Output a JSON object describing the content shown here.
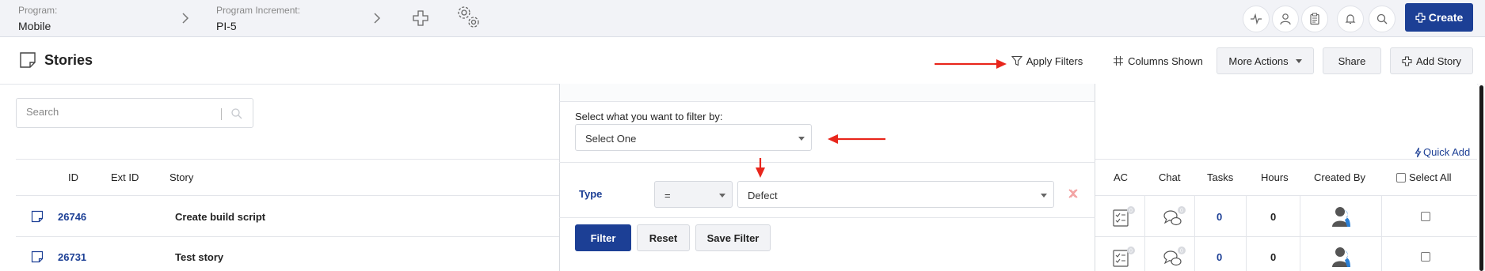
{
  "topbar": {
    "program_label": "Program:",
    "program_value": "Mobile",
    "pi_label": "Program Increment:",
    "pi_value": "PI-5",
    "create_label": "Create",
    "icons": [
      "plus-icon",
      "gears-icon",
      "activity-icon",
      "user-icon",
      "clipboard-icon",
      "bell-icon",
      "search-icon"
    ]
  },
  "page": {
    "title": "Stories",
    "apply_filters": "Apply Filters",
    "columns_shown": "Columns Shown",
    "more_actions": "More Actions",
    "share": "Share",
    "add_story": "Add Story"
  },
  "left_table": {
    "search_placeholder": "Search",
    "headers": [
      "ID",
      "Ext ID",
      "Story"
    ],
    "rows": [
      {
        "id": "26746",
        "ext_id": "",
        "story": "Create build script"
      },
      {
        "id": "26731",
        "ext_id": "",
        "story": "Test story"
      }
    ]
  },
  "filter": {
    "prompt": "Select what you want to filter by:",
    "filter_by_value": "Select One",
    "type_label": "Type",
    "operator_value": "=",
    "type_value": "Defect",
    "filter_button": "Filter",
    "reset_button": "Reset",
    "save_filter_button": "Save Filter"
  },
  "right_table": {
    "quick_add": "Quick Add",
    "headers": [
      "AC",
      "Chat",
      "Tasks",
      "Hours",
      "Created By",
      "Select All"
    ],
    "rows": [
      {
        "ac": "0",
        "chat": "0",
        "tasks": "0",
        "hours": "0"
      },
      {
        "ac": "0",
        "chat": "0",
        "tasks": "0",
        "hours": "0"
      }
    ]
  },
  "colors": {
    "brand_blue": "#1c3f95",
    "annotation_red": "#e8261c",
    "remove_icon": "#f29c9c"
  }
}
